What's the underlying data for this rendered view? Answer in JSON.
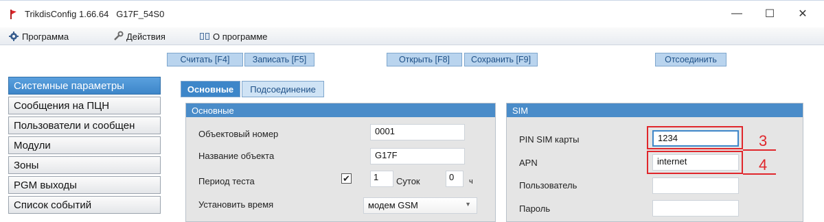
{
  "window": {
    "title": "TrikdisConfig 1.66.64   G17F_54S0",
    "minimize": "—",
    "maximize": "☐",
    "close": "✕"
  },
  "menu": {
    "program": "Программа",
    "actions": "Действия",
    "about": "О программе"
  },
  "toolbar": {
    "read": "Считать [F4]",
    "write": "Записать [F5]",
    "open": "Открыть [F8]",
    "save": "Сохранить [F9]",
    "disconnect": "Отсоединить"
  },
  "sidebar": {
    "items": [
      "Системные параметры",
      "Сообщения на ПЦН",
      "Пользователи и сообщен",
      "Модули",
      "Зоны",
      "PGM выходы",
      "Список событий"
    ],
    "active_index": 0
  },
  "tabs": {
    "main": "Основные",
    "connection": "Подсоединение"
  },
  "main_panel": {
    "header": "Основные",
    "object_number_label": "Объектовый номер",
    "object_number_value": "0001",
    "object_name_label": "Название объекта",
    "object_name_value": "G17F",
    "test_period_label": "Период теста",
    "test_period_checked": "✔",
    "test_days_value": "1",
    "test_days_unit": "Суток",
    "test_hours_value": "0",
    "test_hours_unit": "ч",
    "set_time_label": "Установить время",
    "set_time_value": "модем GSM"
  },
  "sim_panel": {
    "header": "SIM",
    "pin_label": "PIN SIM карты",
    "pin_value": "1234",
    "apn_label": "APN",
    "apn_value": "internet",
    "user_label": "Пользователь",
    "user_value": "",
    "password_label": "Пароль",
    "password_value": ""
  },
  "callouts": {
    "pin": "3",
    "apn": "4"
  },
  "colors": {
    "accent": "#3d86c9",
    "button_bg": "#b9d4ee",
    "callout": "#e0262b"
  },
  "icons": {
    "app": "trikdis-flag-icon",
    "program": "gear-icon",
    "actions": "wrench-icon",
    "about": "book-icon"
  }
}
